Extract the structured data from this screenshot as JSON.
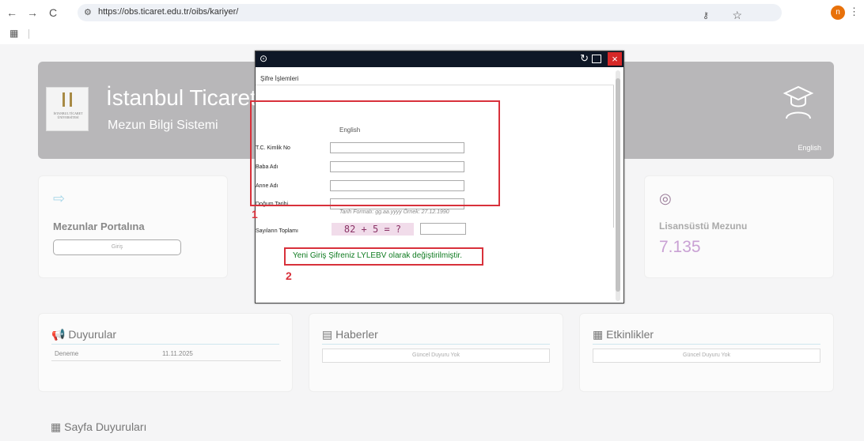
{
  "browser": {
    "url": "https://obs.ticaret.edu.tr/oibs/kariyer/",
    "profile_initial": "n"
  },
  "hero": {
    "title": "İstanbul Ticaret",
    "subtitle": "Mezun Bilgi Sistemi",
    "logo_text": "İSTANBUL TİCARET ÜNİVERSİTESİ",
    "english_label": "English"
  },
  "cards": {
    "portal": {
      "title": "Mezunlar Portalına",
      "button": "Giriş"
    },
    "graduate": {
      "title": "Lisansüstü Mezunu",
      "value": "7.135"
    }
  },
  "sections": {
    "announcements": {
      "title": "Duyurular",
      "item": {
        "name": "Deneme",
        "date": "11.11.2025"
      }
    },
    "news": {
      "title": "Haberler",
      "empty": "Güncel Duyuru Yok"
    },
    "events": {
      "title": "Etkinlikler",
      "empty": "Güncel Duyuru Yok"
    },
    "page_announcements": {
      "title": "Sayfa Duyuruları"
    }
  },
  "popup": {
    "menu": "Şifre İşlemleri",
    "english": "English",
    "fields": [
      {
        "label": "T.C. Kimlik No",
        "value": ""
      },
      {
        "label": "Baba Adı",
        "value": ""
      },
      {
        "label": "Anne Adı",
        "value": ""
      },
      {
        "label": "Doğum Tarihi",
        "value": ""
      }
    ],
    "date_hint": "Tarih Formatı: gg.aa.yyyy   Örnek: 27.12.1990",
    "sum_label": "Sayıların Toplamı",
    "captcha": "82 + 5 = ?",
    "captcha_answer": "",
    "message": "Yeni Giriş Şifreniz LYLEBV olarak değiştirilmiştir."
  },
  "annotations": {
    "one": "1",
    "two": "2"
  },
  "colors": {
    "hero": "#b8b7b9",
    "accent_red": "#d8313b",
    "success_green": "#0f7b20",
    "popup_bar": "#0e1726"
  },
  "icons": [
    "back-arrow-icon",
    "forward-arrow-icon",
    "reload-icon",
    "site-info-icon",
    "password-key-icon",
    "star-icon",
    "profile-avatar",
    "menu-icon",
    "graduation-cap-icon",
    "portal-enter-icon",
    "award-icon",
    "megaphone-icon",
    "newspaper-icon",
    "calendar-icon"
  ]
}
